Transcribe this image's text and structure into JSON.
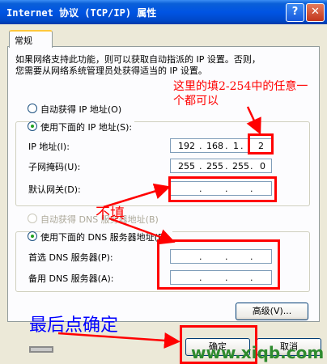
{
  "window": {
    "title": "Internet 协议 (TCP/IP) 属性"
  },
  "tabs": [
    {
      "label": "常规"
    }
  ],
  "description": [
    "如果网络支持此功能，则可以获取自动指派的 IP 设置。否则，",
    "您需要从网络系统管理员处获得适当的 IP 设置。"
  ],
  "ip_section": {
    "auto_label": "自动获得 IP 地址(O)",
    "manual_label": "使用下面的 IP 地址(S):",
    "ip_label": "IP 地址(I):",
    "ip_value": [
      "192",
      "168",
      "1",
      "2"
    ],
    "mask_label": "子网掩码(U):",
    "mask_value": [
      "255",
      "255",
      "255",
      "0"
    ],
    "gateway_label": "默认网关(D):",
    "gateway_value": [
      "",
      "",
      "",
      ""
    ]
  },
  "dns_section": {
    "auto_label": "自动获得 DNS 服务器地址(B)",
    "manual_label": "使用下面的 DNS 服务器地址(E):",
    "preferred_label": "首选 DNS 服务器(P):",
    "alternate_label": "备用 DNS 服务器(A):"
  },
  "buttons": {
    "advanced": "高级(V)...",
    "ok": "确定",
    "cancel": "取消"
  },
  "annotations": {
    "ip_hint_line1": "这里的填2-254中的任意一",
    "ip_hint_line2": "个都可以",
    "no_fill": "不填",
    "final": "最后点确定"
  },
  "watermark": "www.xiqb.com",
  "colors": {
    "titlebar": "#0054e3",
    "annotation": "#ff0000",
    "annotation_blue": "#0000ff",
    "watermark": "#2e8b2e"
  }
}
